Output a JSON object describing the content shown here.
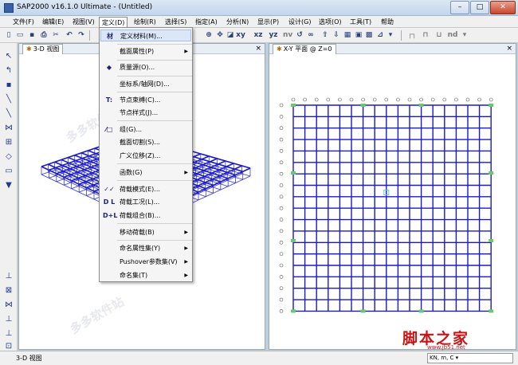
{
  "window": {
    "title": "SAP2000 v16.1.0 Ultimate  - (Untitled)",
    "min_label": "–",
    "max_label": "□",
    "close_label": "✕"
  },
  "menubar": [
    {
      "label": "文件(F)"
    },
    {
      "label": "编辑(E)"
    },
    {
      "label": "视图(V)"
    },
    {
      "label": "定义(D)"
    },
    {
      "label": "绘制(R)"
    },
    {
      "label": "选择(S)"
    },
    {
      "label": "指定(A)"
    },
    {
      "label": "分析(N)"
    },
    {
      "label": "显示(P)"
    },
    {
      "label": "设计(G)"
    },
    {
      "label": "选项(O)"
    },
    {
      "label": "工具(T)"
    },
    {
      "label": "帮助"
    }
  ],
  "toolbar": {
    "xy": "xy",
    "xz": "xz",
    "yz": "yz",
    "nv": "nv",
    "nd": "nd",
    "dropdown": "▾"
  },
  "left_view": {
    "tab_label": "3-D 视图"
  },
  "right_view": {
    "tab_label": "X-Y 平面 @ Z=0"
  },
  "panel_close": "×",
  "define_menu": {
    "items": [
      {
        "label": "定义材料(M)...",
        "icon": "材",
        "submenu": false
      },
      {
        "label": "截面属性(P)",
        "icon": "",
        "submenu": true
      },
      {
        "label": "质量源(O)...",
        "icon": "◆",
        "submenu": false
      },
      {
        "label": "坐标系/轴网(D)...",
        "icon": "",
        "submenu": false
      },
      {
        "label": "节点束缚(C)...",
        "icon": "T:",
        "submenu": false
      },
      {
        "label": "节点样式(J)...",
        "icon": "",
        "submenu": false
      },
      {
        "label": "组(G)...",
        "icon": "⁄□",
        "submenu": false
      },
      {
        "label": "截面切割(S)...",
        "icon": "",
        "submenu": false
      },
      {
        "label": "广义位移(Z)...",
        "icon": "",
        "submenu": false
      },
      {
        "label": "函数(G)",
        "icon": "",
        "submenu": true
      },
      {
        "label": "荷载模式(E)...",
        "icon": "✓✓",
        "submenu": false
      },
      {
        "label": "荷载工况(L)...",
        "icon": "D L",
        "submenu": false
      },
      {
        "label": "荷载组合(B)...",
        "icon": "D+L",
        "submenu": false
      },
      {
        "label": "移动荷载(B)",
        "icon": "",
        "submenu": true
      },
      {
        "label": "命名属性集(Y)",
        "icon": "",
        "submenu": true
      },
      {
        "label": "Pushover参数集(V)",
        "icon": "",
        "submenu": true
      },
      {
        "label": "命名集(T)",
        "icon": "",
        "submenu": true
      }
    ]
  },
  "statusbar": {
    "text": "3-D 视图",
    "units": "KN, m, C ▾"
  },
  "watermark": {
    "logo_text": "脚本之家",
    "url_text": "www.jb51.net"
  }
}
